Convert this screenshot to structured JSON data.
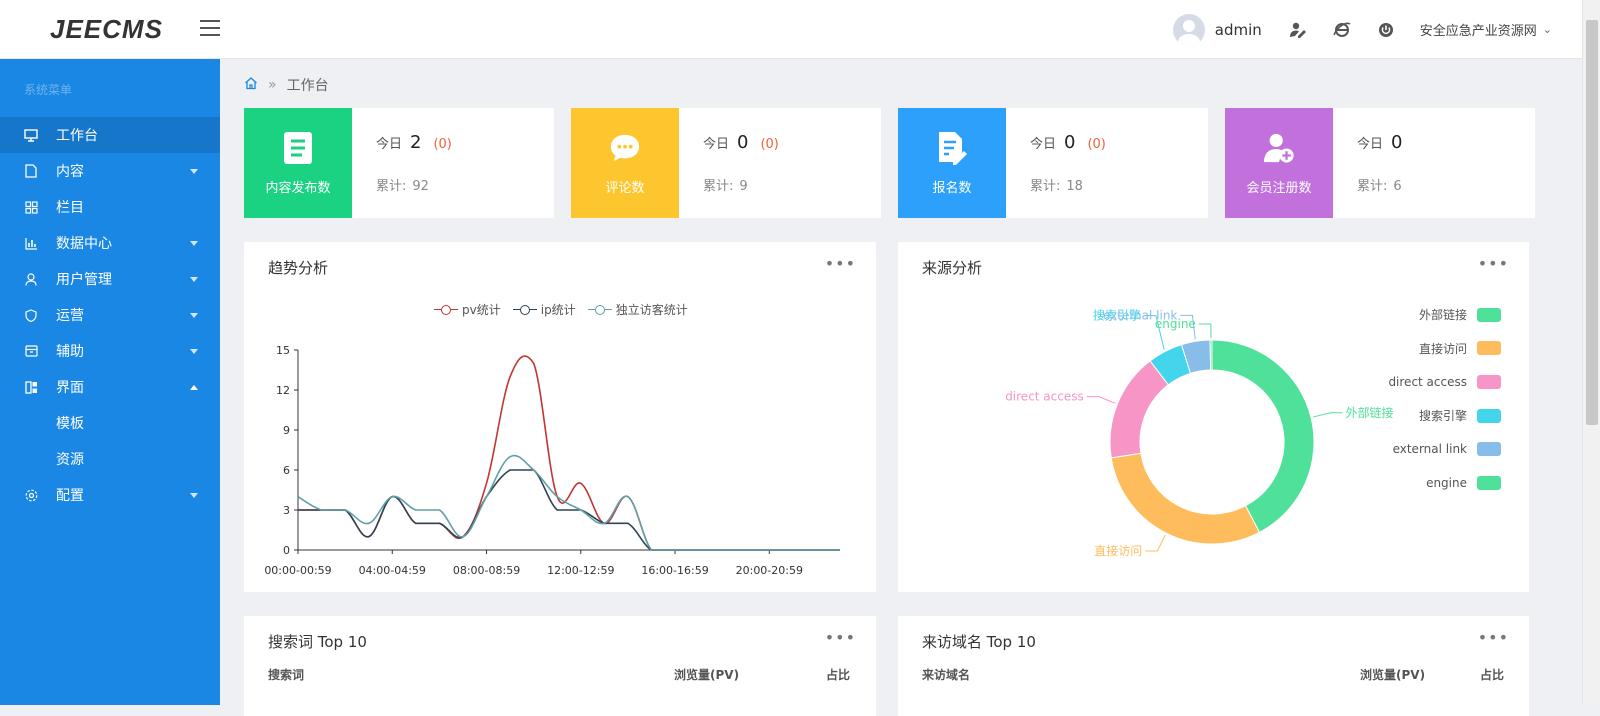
{
  "app": {
    "logo": "JEECMS"
  },
  "header": {
    "username": "admin",
    "site_name": "安全应急产业资源网",
    "icons": [
      "user-edit-icon",
      "ie-browser-icon",
      "power-icon"
    ]
  },
  "sidebar": {
    "menu_title": "系统菜单",
    "items": [
      {
        "label": "工作台",
        "icon": "monitor-icon",
        "active": true
      },
      {
        "label": "内容",
        "icon": "document-icon",
        "caret": "down"
      },
      {
        "label": "栏目",
        "icon": "grid-icon"
      },
      {
        "label": "数据中心",
        "icon": "bar-chart-icon",
        "caret": "down"
      },
      {
        "label": "用户管理",
        "icon": "user-icon",
        "caret": "down"
      },
      {
        "label": "运营",
        "icon": "shield-icon",
        "caret": "down"
      },
      {
        "label": "辅助",
        "icon": "box-icon",
        "caret": "down"
      },
      {
        "label": "界面",
        "icon": "layout-icon",
        "caret": "up"
      },
      {
        "label": "配置",
        "icon": "gear-icon",
        "caret": "down"
      }
    ],
    "subitems": [
      "模板",
      "资源"
    ]
  },
  "breadcrumb": {
    "current": "工作台"
  },
  "stats": [
    {
      "label": "内容发布数",
      "icon": "document-list-icon",
      "color": "#1bd182",
      "today_label": "今日",
      "today": "2",
      "today_delta": "(0)",
      "total_label": "累计:",
      "total": "92"
    },
    {
      "label": "评论数",
      "icon": "comment-icon",
      "color": "#fec62e",
      "today_label": "今日",
      "today": "0",
      "today_delta": "(0)",
      "total_label": "累计:",
      "total": "9"
    },
    {
      "label": "报名数",
      "icon": "form-edit-icon",
      "color": "#2ca0fb",
      "today_label": "今日",
      "today": "0",
      "today_delta": "(0)",
      "total_label": "累计:",
      "total": "18"
    },
    {
      "label": "会员注册数",
      "icon": "add-member-icon",
      "color": "#c170dc",
      "today_label": "今日",
      "today": "0",
      "today_delta": "",
      "total_label": "累计:",
      "total": "6"
    }
  ],
  "trend": {
    "title": "趋势分析",
    "more": "•••"
  },
  "source": {
    "title": "来源分析",
    "more": "•••"
  },
  "search_top": {
    "title": "搜索词 Top 10",
    "more": "•••",
    "columns": [
      "搜索词",
      "浏览量(PV)",
      "占比"
    ]
  },
  "domain_top": {
    "title": "来访域名 Top 10",
    "more": "•••",
    "columns": [
      "来访域名",
      "浏览量(PV)",
      "占比"
    ]
  },
  "chart_data": [
    {
      "type": "line",
      "title": "趋势分析",
      "x_tick_labels": [
        "00:00-00:59",
        "04:00-04:59",
        "08:00-08:59",
        "12:00-12:59",
        "16:00-16:59",
        "20:00-20:59"
      ],
      "x_hours": [
        0,
        1,
        2,
        3,
        4,
        5,
        6,
        7,
        8,
        9,
        10,
        11,
        12,
        13,
        14,
        15,
        16,
        17,
        18,
        19,
        20,
        21,
        22,
        23
      ],
      "ylim": [
        0,
        15
      ],
      "y_ticks": [
        0,
        3,
        6,
        9,
        12,
        15
      ],
      "grid": false,
      "legend_position": "top-center",
      "series": [
        {
          "name": "pv统计",
          "color": "#c23531",
          "values": [
            3,
            3,
            3,
            1,
            4,
            2,
            2,
            1,
            5,
            13,
            14,
            4,
            5,
            2,
            4,
            0,
            0,
            0,
            0,
            0,
            0,
            0,
            0,
            0
          ]
        },
        {
          "name": "ip统计",
          "color": "#2f4554",
          "values": [
            3,
            3,
            3,
            1,
            4,
            2,
            2,
            1,
            4,
            6,
            6,
            3,
            3,
            2,
            2,
            0,
            0,
            0,
            0,
            0,
            0,
            0,
            0,
            0
          ]
        },
        {
          "name": "独立访客统计",
          "color": "#61a0a8",
          "values": [
            4,
            3,
            3,
            2,
            4,
            3,
            3,
            1,
            4,
            7,
            6,
            4,
            3,
            2,
            4,
            0,
            0,
            0,
            0,
            0,
            0,
            0,
            0,
            0
          ]
        }
      ]
    },
    {
      "type": "pie",
      "title": "来源分析",
      "variant": "donut",
      "legend_position": "right",
      "series": [
        {
          "name": "外部链接",
          "color": "#4fe09a",
          "value": 42
        },
        {
          "name": "直接访问",
          "color": "#ffbc5c",
          "value": 30
        },
        {
          "name": "direct access",
          "color": "#f796c6",
          "value": 17
        },
        {
          "name": "搜索引擎",
          "color": "#43d5eb",
          "value": 5.5
        },
        {
          "name": "external link",
          "color": "#88bce9",
          "value": 4.5
        },
        {
          "name": "engine",
          "color": "#4fe09a",
          "value": 0.3
        }
      ]
    }
  ]
}
